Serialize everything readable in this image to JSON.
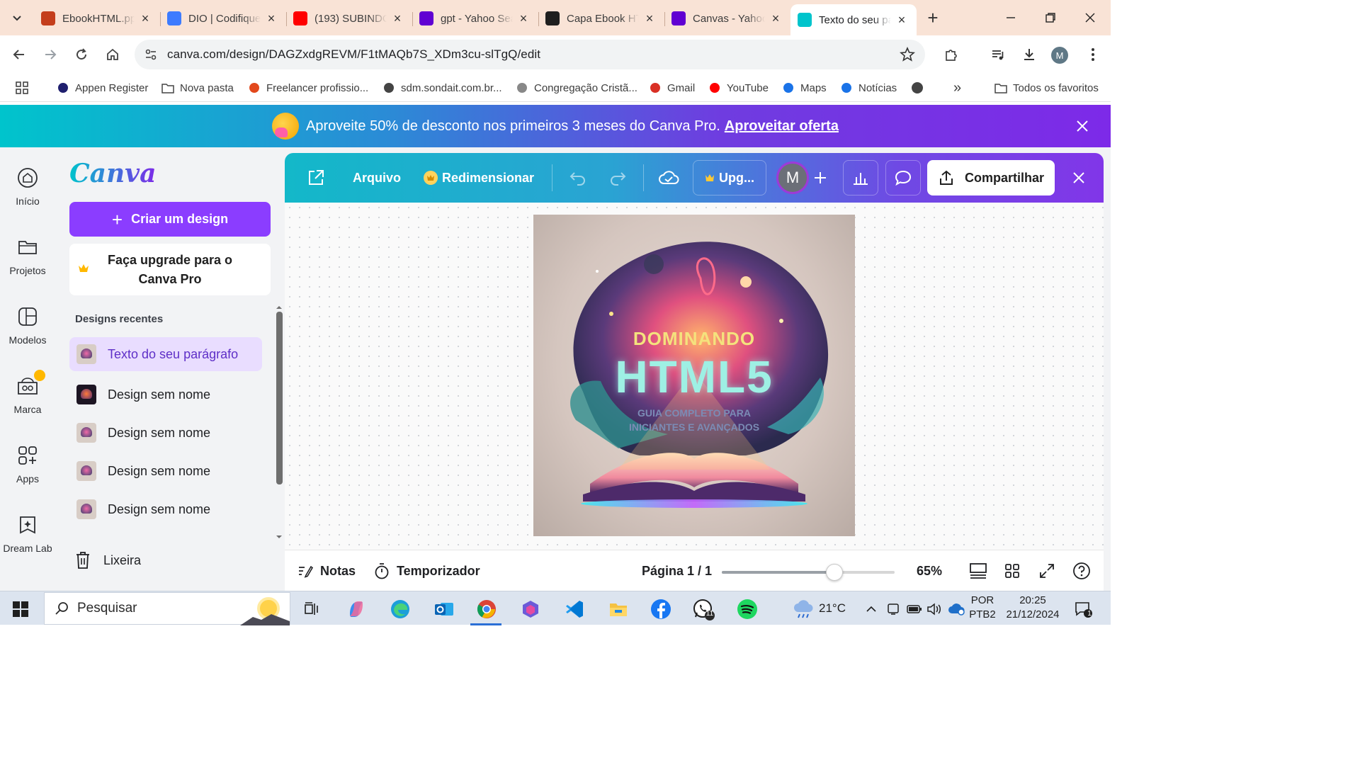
{
  "browser": {
    "tabs": [
      {
        "title": "EbookHTML.pptx",
        "favicon": "powerpoint-icon",
        "color": "#c43e1c",
        "active": false
      },
      {
        "title": "DIO | Codifique o seu futuro",
        "favicon": "dio-icon",
        "color": "#3d7bff",
        "active": false
      },
      {
        "title": "(193) SUBINDO",
        "favicon": "youtube-icon",
        "color": "#ff0000",
        "active": false
      },
      {
        "title": "gpt - Yahoo Search",
        "favicon": "yahoo-icon",
        "color": "#6001d2",
        "active": false
      },
      {
        "title": "Capa Ebook HTML",
        "favicon": "chatgpt-icon",
        "color": "#1f1f1f",
        "active": false
      },
      {
        "title": "Canvas - Yahoo Search",
        "favicon": "yahoo-icon",
        "color": "#6001d2",
        "active": false
      },
      {
        "title": "Texto do seu parágrafo",
        "favicon": "canva-icon",
        "color": "#00c4cc",
        "active": true
      }
    ],
    "url": "canva.com/design/DAGZxdgREVM/F1tMAQb7S_XDm3cu-slTgQ/edit",
    "profile_initial": "M",
    "bookmarks": [
      {
        "label": "Appen Register",
        "icon": "appen-icon"
      },
      {
        "label": "Nova pasta",
        "icon": "folder-icon"
      },
      {
        "label": "Freelancer profissio...",
        "icon": "freelancer-icon"
      },
      {
        "label": "sdm.sondait.com.br...",
        "icon": "globe-icon"
      },
      {
        "label": "Congregação Cristã...",
        "icon": "ccb-icon"
      },
      {
        "label": "Gmail",
        "icon": "gmail-icon"
      },
      {
        "label": "YouTube",
        "icon": "youtube-icon"
      },
      {
        "label": "Maps",
        "icon": "maps-icon"
      },
      {
        "label": "Notícias",
        "icon": "news-icon"
      }
    ],
    "more_bookmarks": "»",
    "all_bookmarks": "Todos os favoritos"
  },
  "promo": {
    "text": "Aproveite 50% de desconto nos primeiros 3 meses do Canva Pro.",
    "link": "Aproveitar oferta"
  },
  "rail": [
    {
      "label": "Início",
      "icon": "home-icon"
    },
    {
      "label": "Projetos",
      "icon": "folder-icon"
    },
    {
      "label": "Modelos",
      "icon": "templates-icon"
    },
    {
      "label": "Marca",
      "icon": "brand-icon"
    },
    {
      "label": "Apps",
      "icon": "apps-icon"
    },
    {
      "label": "Dream Lab",
      "icon": "dream-lab-icon"
    }
  ],
  "sidebar": {
    "logo": "Canva",
    "create_button": "Criar um design",
    "upgrade": "Faça upgrade para o Canva Pro",
    "recent_label": "Designs recentes",
    "recent": [
      {
        "label": "Texto do seu parágrafo",
        "active": true
      },
      {
        "label": "Design sem nome",
        "active": false
      },
      {
        "label": "Design sem nome",
        "active": false
      },
      {
        "label": "Design sem nome",
        "active": false
      },
      {
        "label": "Design sem nome",
        "active": false
      }
    ],
    "trash": "Lixeira"
  },
  "editor": {
    "menu_file": "Arquivo",
    "menu_resize": "Redimensionar",
    "upgrade_short": "Upg...",
    "collaborator_initial": "M",
    "share": "Compartilhar",
    "cover": {
      "line1": "DOMINANDO",
      "line2": "HTML5",
      "line3a": "GUIA COMPLETO PARA",
      "line3b": "INICIANTES E AVANÇADOS"
    },
    "notes": "Notas",
    "timer": "Temporizador",
    "page": "Página 1 / 1",
    "zoom": "65%",
    "zoom_fraction": 0.65,
    "accent": "#8b3dff"
  },
  "taskbar": {
    "search_placeholder": "Pesquisar",
    "weather": "21°C",
    "lang1": "POR",
    "lang2": "PTB2",
    "time": "20:25",
    "date": "21/12/2024",
    "whatsapp_badge": "11",
    "notification_badge": "1"
  }
}
